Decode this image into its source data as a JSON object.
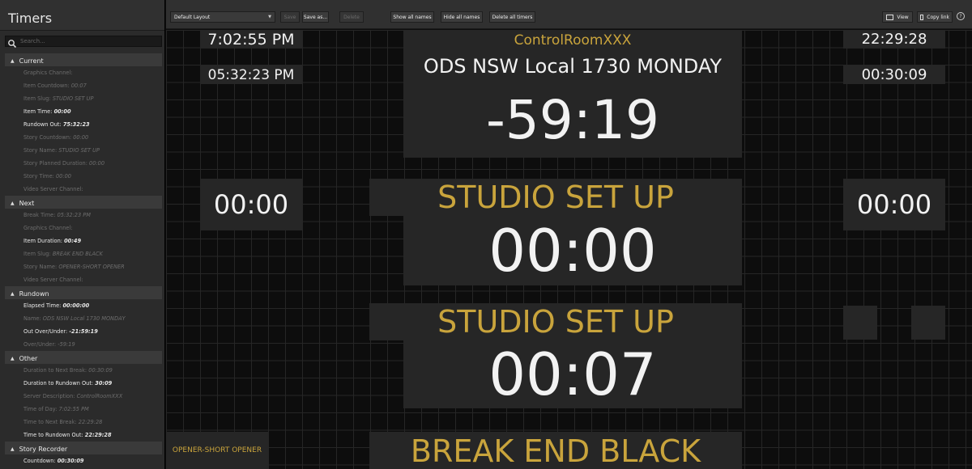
{
  "app": {
    "title": "Timers"
  },
  "search": {
    "placeholder": "Search..."
  },
  "sidebar": {
    "sections": [
      {
        "title": "Current",
        "items": [
          {
            "label": "Graphics Channel:",
            "value": "",
            "bright": false
          },
          {
            "label": "Item Countdown:",
            "value": "00:07",
            "bright": false
          },
          {
            "label": "Item Slug:",
            "value": "STUDIO SET UP",
            "bright": false
          },
          {
            "label": "Item Time:",
            "value": "00:00",
            "bright": true
          },
          {
            "label": "Rundown Out:",
            "value": "75:32:23",
            "bright": true
          },
          {
            "label": "Story Countdown:",
            "value": "00:00",
            "bright": false
          },
          {
            "label": "Story Name:",
            "value": "STUDIO SET UP",
            "bright": false
          },
          {
            "label": "Story Planned Duration:",
            "value": "00:00",
            "bright": false
          },
          {
            "label": "Story Time:",
            "value": "00:00",
            "bright": false
          },
          {
            "label": "Video Server Channel:",
            "value": "",
            "bright": false
          }
        ]
      },
      {
        "title": "Next",
        "items": [
          {
            "label": "Break Time:",
            "value": "05:32:23 PM",
            "bright": false
          },
          {
            "label": "Graphics Channel:",
            "value": "",
            "bright": false
          },
          {
            "label": "Item Duration:",
            "value": "00:49",
            "bright": true
          },
          {
            "label": "Item Slug:",
            "value": "BREAK END BLACK",
            "bright": false
          },
          {
            "label": "Story Name:",
            "value": "OPENER-SHORT OPENER",
            "bright": false
          },
          {
            "label": "Video Server Channel:",
            "value": "",
            "bright": false
          }
        ]
      },
      {
        "title": "Rundown",
        "items": [
          {
            "label": "Elapsed Time:",
            "value": "00:00:00",
            "bright": true
          },
          {
            "label": "Name:",
            "value": "ODS NSW Local 1730 MONDAY",
            "bright": false
          },
          {
            "label": "Out Over/Under:",
            "value": "-21:59:19",
            "bright": true
          },
          {
            "label": "Over/Under:",
            "value": "-59:19",
            "bright": false
          }
        ]
      },
      {
        "title": "Other",
        "items": [
          {
            "label": "Duration to Next Break:",
            "value": "00:30:09",
            "bright": false
          },
          {
            "label": "Duration to Rundown Out:",
            "value": "30:09",
            "bright": true
          },
          {
            "label": "Server Description:",
            "value": "ControlRoomXXX",
            "bright": false
          },
          {
            "label": "Time of Day:",
            "value": "7:02:55 PM",
            "bright": false
          },
          {
            "label": "Time to Next Break:",
            "value": "22:29:28",
            "bright": false
          },
          {
            "label": "Time to Rundown Out:",
            "value": "22:29:28",
            "bright": true
          }
        ]
      },
      {
        "title": "Story Recorder",
        "items": [
          {
            "label": "Countdown:",
            "value": "00:30:09",
            "bright": true
          }
        ]
      }
    ]
  },
  "toolbar": {
    "layout_value": "Default Layout",
    "save": "Save",
    "save_as": "Save as...",
    "delete": "Delete",
    "show_all": "Show all names",
    "hide_all": "Hide all names",
    "delete_all": "Delete all timers",
    "view": "View",
    "copy_link": "Copy link",
    "help": "?"
  },
  "panels": {
    "time_of_day": "7:02:55 PM",
    "break_time": "05:32:23 PM",
    "server_desc": "ControlRoomXXX",
    "rundown_name": "ODS NSW Local 1730 MONDAY",
    "over_under": "-59:19",
    "time_to_break": "22:29:28",
    "duration_to_break": "00:30:09",
    "left_timer": "00:00",
    "right_timer": "00:00",
    "story_name": "STUDIO SET UP",
    "story_time": "00:00",
    "item_slug": "STUDIO SET UP",
    "item_countdown": "00:07",
    "next_story_name": "OPENER-SHORT OPENER",
    "next_item_slug": "BREAK END BLACK"
  },
  "colors": {
    "accent": "#c9a43c",
    "panel": "#262626",
    "text": "#f2f2f2"
  }
}
